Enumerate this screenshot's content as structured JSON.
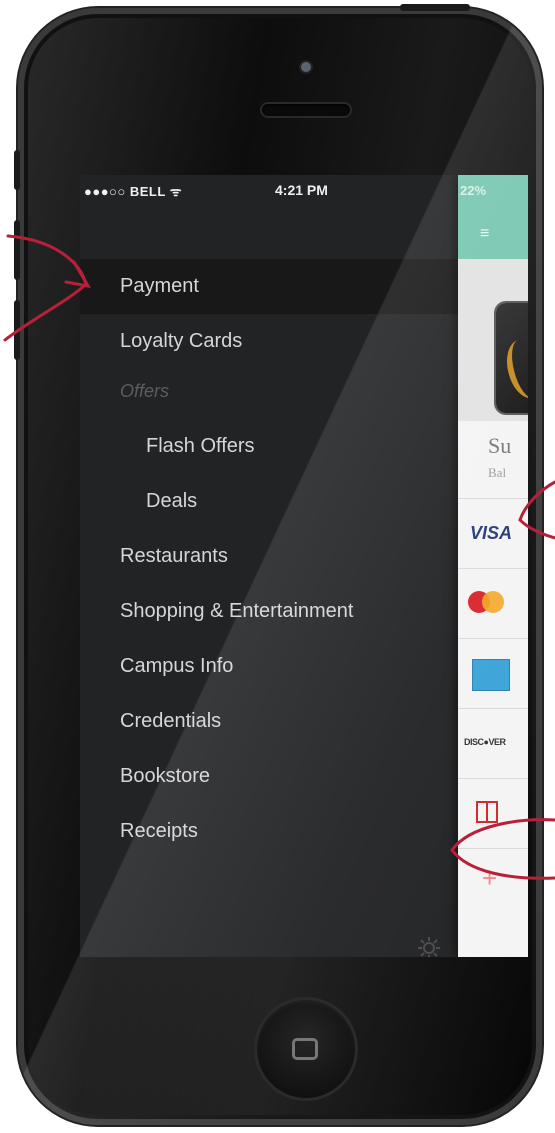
{
  "status_bar": {
    "carrier": "●●●○○ BELL ᯤ",
    "time": "4:21 PM",
    "battery": "22%"
  },
  "menu": {
    "items": [
      {
        "label": "Payment",
        "type": "item",
        "active": true
      },
      {
        "label": "Loyalty Cards",
        "type": "item"
      },
      {
        "label": "Offers",
        "type": "section"
      },
      {
        "label": "Flash Offers",
        "type": "sub"
      },
      {
        "label": "Deals",
        "type": "sub"
      },
      {
        "label": "Restaurants",
        "type": "item"
      },
      {
        "label": "Shopping & Entertainment",
        "type": "item"
      },
      {
        "label": "Campus Info",
        "type": "item"
      },
      {
        "label": "Credentials",
        "type": "item"
      },
      {
        "label": "Bookstore",
        "type": "item"
      },
      {
        "label": "Receipts",
        "type": "item"
      }
    ],
    "settings_icon": "gear-icon"
  },
  "panel": {
    "header_icon": "hamburger-icon",
    "header_glyph": "≡",
    "card_title": "Su",
    "card_subtitle": "Bal",
    "payment_methods": {
      "visa": "VISA",
      "mastercard": "MasterCard",
      "amex": "American Express",
      "discover": "DISC●VER",
      "gift": "gift-icon",
      "add": "+"
    }
  },
  "colors": {
    "accent": "#76c6b0",
    "menu_bg": "#222325",
    "active_bg": "#181818",
    "annotation": "#b8203a"
  }
}
